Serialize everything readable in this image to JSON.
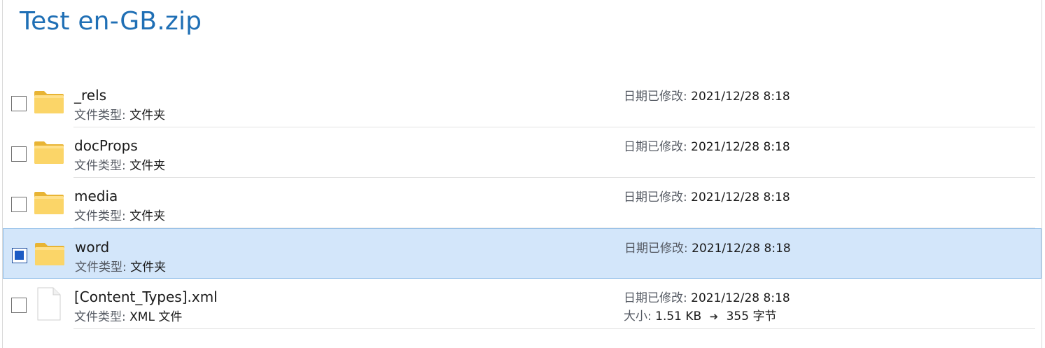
{
  "page": {
    "title": "Test en-GB.zip"
  },
  "labels": {
    "file_type": "文件类型:",
    "date_modified": "日期已修改:",
    "size": "大小:"
  },
  "items": [
    {
      "name": "_rels",
      "type": "文件夹",
      "modified": "2021/12/28 8:18",
      "icon": "folder-icon",
      "selected": false
    },
    {
      "name": "docProps",
      "type": "文件夹",
      "modified": "2021/12/28 8:18",
      "icon": "folder-icon",
      "selected": false
    },
    {
      "name": "media",
      "type": "文件夹",
      "modified": "2021/12/28 8:18",
      "icon": "folder-icon",
      "selected": false
    },
    {
      "name": "word",
      "type": "文件夹",
      "modified": "2021/12/28 8:18",
      "icon": "folder-icon",
      "selected": true
    },
    {
      "name": "[Content_Types].xml",
      "type": "XML 文件",
      "modified": "2021/12/28 8:18",
      "icon": "file-icon",
      "selected": false,
      "size_compressed": "1.51 KB",
      "size_arrow": "➜",
      "size_uncompressed": "355 字节"
    }
  ],
  "colors": {
    "title": "#1f6fb5",
    "selected_background": "#d3e6fa",
    "selected_border": "#8fbde8",
    "checkbox_checked": "#1c5bc4",
    "folder": "#f8cd55"
  }
}
